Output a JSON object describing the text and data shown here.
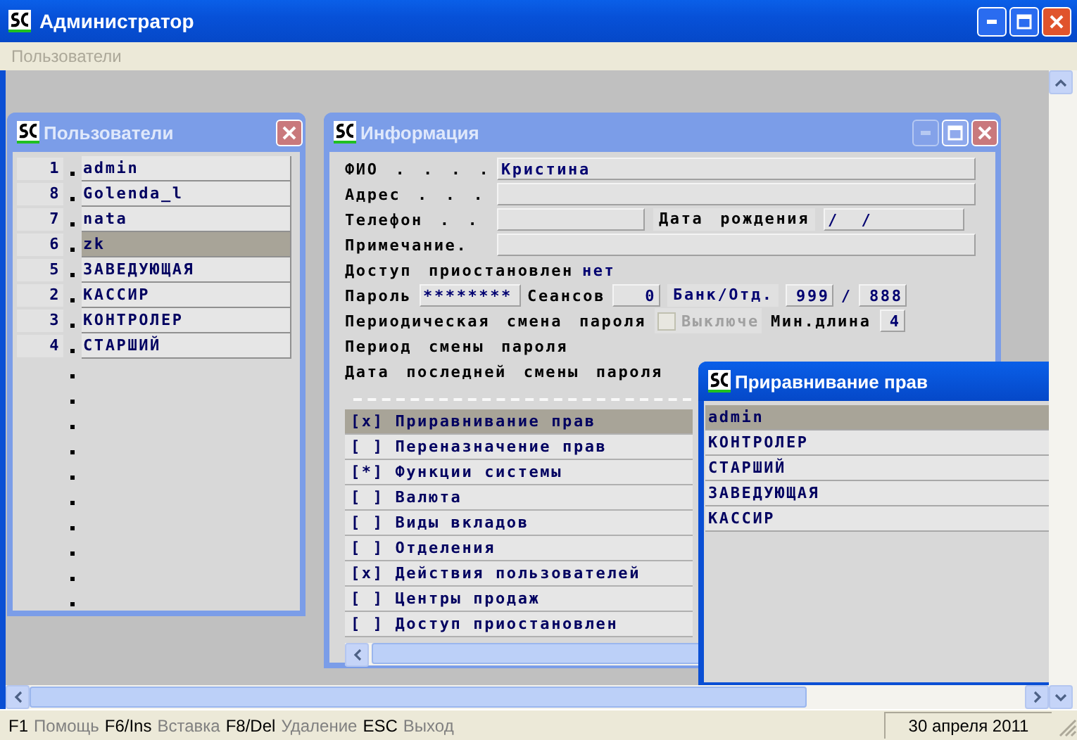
{
  "window": {
    "title": "Администратор",
    "buttons": [
      {
        "kind": "minimize",
        "disabled": false
      },
      {
        "kind": "maximize",
        "disabled": false
      },
      {
        "kind": "close",
        "disabled": false
      }
    ]
  },
  "menu": [
    {
      "label": "Пользователи",
      "disabled": true
    }
  ],
  "users_window": {
    "title": "Пользователи",
    "active": false,
    "buttons": [
      {
        "kind": "close",
        "disabled": false
      }
    ],
    "items": [
      {
        "number": "1",
        "name": "admin",
        "selected": false
      },
      {
        "number": "8",
        "name": "Golenda_l",
        "selected": false
      },
      {
        "number": "7",
        "name": "nata",
        "selected": false
      },
      {
        "number": "6",
        "name": "zk",
        "selected": true
      },
      {
        "number": "5",
        "name": "ЗАВЕДУЮЩАЯ",
        "selected": false
      },
      {
        "number": "2",
        "name": "КАССИР",
        "selected": false
      },
      {
        "number": "3",
        "name": "КОНТРОЛЕР",
        "selected": false
      },
      {
        "number": "4",
        "name": "СТАРШИЙ",
        "selected": false
      }
    ]
  },
  "info_window": {
    "title": "Информация",
    "active": false,
    "buttons": [
      {
        "kind": "minimize",
        "disabled": true
      },
      {
        "kind": "maximize",
        "disabled": false
      },
      {
        "kind": "close",
        "disabled": false
      }
    ],
    "fio": {
      "label": "ФИО . . . .",
      "value": "Кристина"
    },
    "address": {
      "label": "Адрес . . ."
    },
    "phone": {
      "label": "Телефон . ."
    },
    "birth_date": {
      "label": "Дата рождения",
      "value": "/  /"
    },
    "note": {
      "label": "Примечание."
    },
    "access": {
      "label": "Доступ приостановлен",
      "value": "нет"
    },
    "password": {
      "label": "Пароль",
      "value": "********"
    },
    "sessions": {
      "label": "Сеансов",
      "value": "0"
    },
    "bank": {
      "label": "Банк/Отд.",
      "bank": "999",
      "separator": "/",
      "branch": "888"
    },
    "periodic_change": {
      "label": "Периодическая смена пароля",
      "checkbox_label": "Выключе",
      "checked": false,
      "disabled": true
    },
    "min_length": {
      "label": "Мин.длина",
      "value": "4"
    },
    "period_label": "Период смены пароля",
    "last_change_label": "Дата последней смены пароля",
    "rights": [
      {
        "mark": "[x]",
        "label": "Приравнивание прав",
        "selected": true
      },
      {
        "mark": "[ ]",
        "label": "Переназначение прав",
        "selected": false
      },
      {
        "mark": "[*]",
        "label": "Функции системы",
        "selected": false
      },
      {
        "mark": "[ ]",
        "label": "Валюта",
        "selected": false
      },
      {
        "mark": "[ ]",
        "label": "Виды вкладов",
        "selected": false
      },
      {
        "mark": "[ ]",
        "label": "Отделения",
        "selected": false
      },
      {
        "mark": "[x]",
        "label": "Действия пользователей",
        "selected": false
      },
      {
        "mark": "[ ]",
        "label": "Центры продаж",
        "selected": false
      },
      {
        "mark": "[ ]",
        "label": "Доступ приостановлен",
        "selected": false
      }
    ]
  },
  "rights_window": {
    "title": "Приравнивание прав",
    "active": true,
    "items": [
      {
        "name": "admin",
        "selected": true
      },
      {
        "name": "КОНТРОЛЕР",
        "selected": false
      },
      {
        "name": "СТАРШИЙ",
        "selected": false
      },
      {
        "name": "ЗАВЕДУЮЩАЯ",
        "selected": false
      },
      {
        "name": "КАССИР",
        "selected": false
      }
    ]
  },
  "status_bar": {
    "hints": [
      {
        "key": "F1",
        "action": "Помощь"
      },
      {
        "key": "F6/Ins",
        "action": "Вставка"
      },
      {
        "key": "F8/Del",
        "action": "Удаление"
      },
      {
        "key": "ESC",
        "action": "Выход"
      }
    ],
    "date": "30 апреля 2011"
  }
}
